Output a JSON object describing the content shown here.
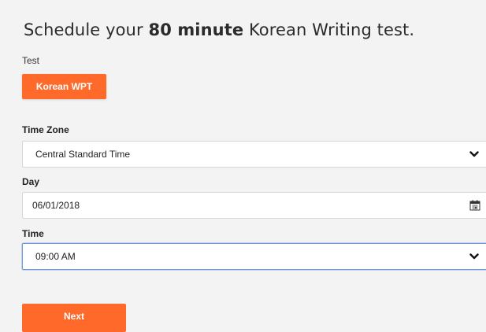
{
  "heading": {
    "prefix": "Schedule your ",
    "bold": "80 minute",
    "suffix": " Korean Writing test."
  },
  "test": {
    "label": "Test",
    "selected_button": "Korean WPT"
  },
  "timezone": {
    "label": "Time Zone",
    "value": "Central Standard Time"
  },
  "day": {
    "label": "Day",
    "value": "06/01/2018"
  },
  "time": {
    "label": "Time",
    "value": "09:00 AM"
  },
  "next_button": "Next",
  "colors": {
    "accent": "#ff6a2b",
    "background": "#f3f3f3",
    "focus_border": "#6b9bd8"
  },
  "icons": {
    "select_arrow": "chevron-down-icon",
    "date_picker": "calendar-icon"
  }
}
